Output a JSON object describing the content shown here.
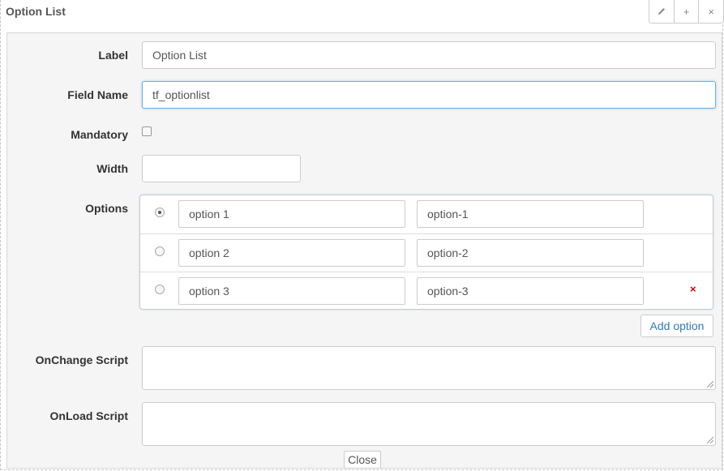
{
  "window": {
    "title": "Option List"
  },
  "toolbar": {
    "edit_icon": "pencil-icon",
    "add_icon": "plus-icon",
    "close_icon": "close-icon"
  },
  "form": {
    "label": {
      "label": "Label",
      "value": "Option List"
    },
    "field_name": {
      "label": "Field Name",
      "value": "tf_optionlist"
    },
    "mandatory": {
      "label": "Mandatory",
      "checked": false
    },
    "width": {
      "label": "Width",
      "value": ""
    },
    "options": {
      "label": "Options",
      "items": [
        {
          "text": "option 1",
          "value": "option-1",
          "selected": true
        },
        {
          "text": "option 2",
          "value": "option-2",
          "selected": false
        },
        {
          "text": "option 3",
          "value": "option-3",
          "selected": false,
          "remove": "×"
        }
      ],
      "add_label": "Add option"
    },
    "onchange_script": {
      "label": "OnChange Script",
      "value": ""
    },
    "onload_script": {
      "label": "OnLoad Script",
      "value": ""
    }
  },
  "footer": {
    "close_label": "Close"
  },
  "colors": {
    "link": "#337ab7",
    "remove": "#cc0000",
    "focus": "#66afe9"
  }
}
